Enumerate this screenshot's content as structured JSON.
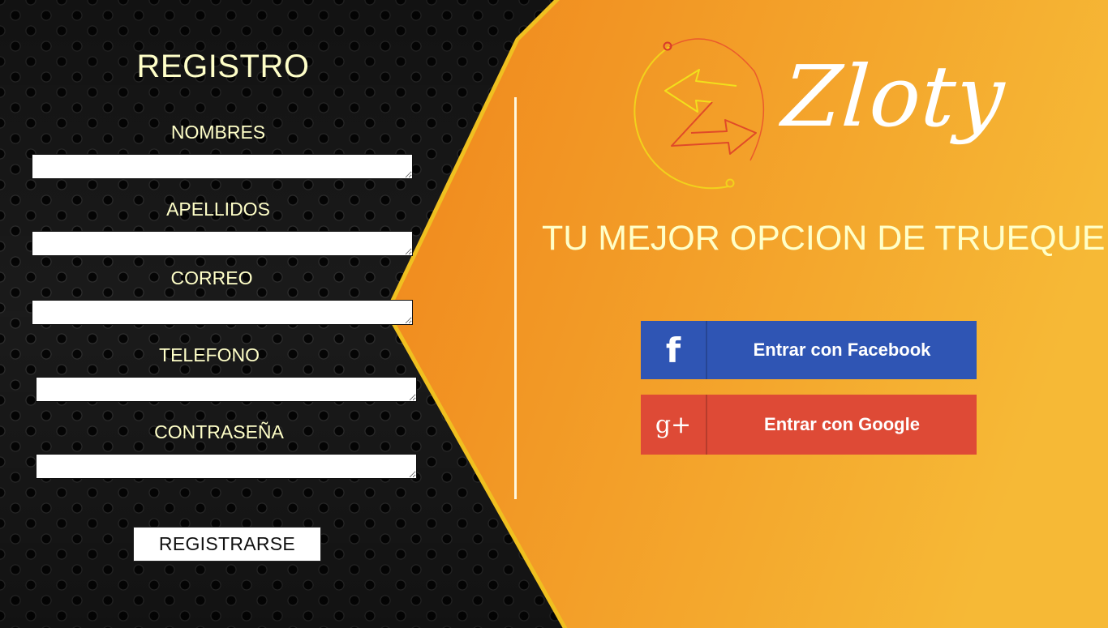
{
  "form": {
    "title": "REGISTRO",
    "fields": [
      {
        "label": "NOMBRES",
        "value": ""
      },
      {
        "label": "APELLIDOS",
        "value": ""
      },
      {
        "label": "CORREO",
        "value": ""
      },
      {
        "label": "TELEFONO",
        "value": ""
      },
      {
        "label": "CONTRASEÑA",
        "value": ""
      }
    ],
    "submit_label": "REGISTRARSE"
  },
  "brand": {
    "name": "Zloty",
    "logo_icon": "swap-arrows-icon",
    "tagline": "TU MEJOR OPCION DE TRUEQUE"
  },
  "social": {
    "facebook": {
      "icon": "facebook-f",
      "glyph": "f",
      "label": "Entrar con Facebook",
      "color": "#2f55b4"
    },
    "google": {
      "icon": "google-plus",
      "glyph": "g+",
      "label": "Entrar con Google",
      "color": "#de4a36"
    }
  },
  "colors": {
    "accent": "#f39a22",
    "label_text": "#ffffc8"
  }
}
